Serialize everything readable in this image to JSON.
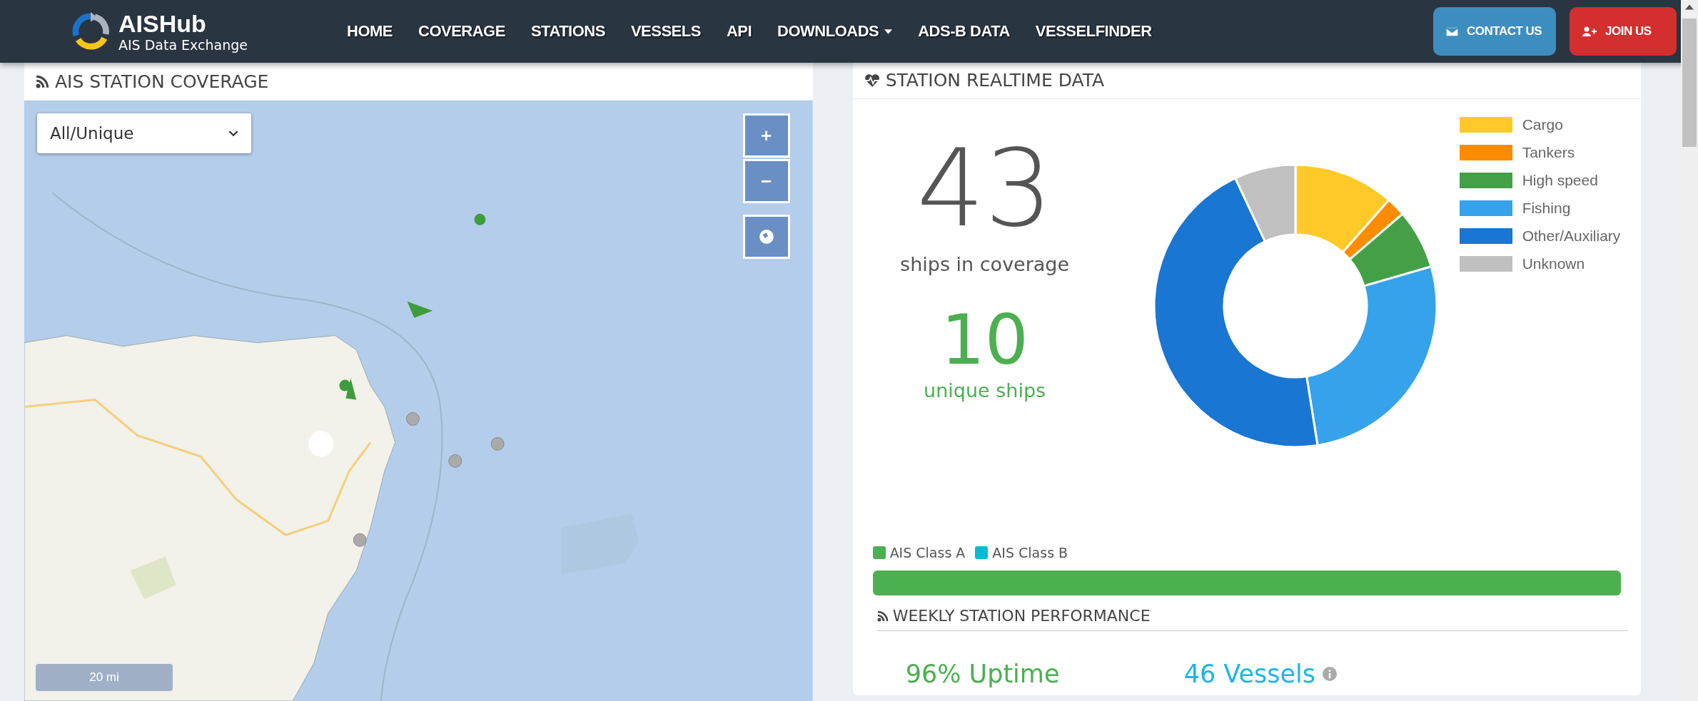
{
  "brand": {
    "name": "AISHub",
    "tagline": "AIS Data Exchange"
  },
  "nav": [
    {
      "label": "HOME",
      "dropdown": false
    },
    {
      "label": "COVERAGE",
      "dropdown": false
    },
    {
      "label": "STATIONS",
      "dropdown": false
    },
    {
      "label": "VESSELS",
      "dropdown": false
    },
    {
      "label": "API",
      "dropdown": false
    },
    {
      "label": "DOWNLOADS",
      "dropdown": true
    },
    {
      "label": "ADS-B DATA",
      "dropdown": false
    },
    {
      "label": "VESSELFINDER",
      "dropdown": false
    }
  ],
  "header_buttons": [
    {
      "label": "CONTACT US",
      "kind": "contact"
    },
    {
      "label": "JOIN US",
      "kind": "join"
    }
  ],
  "coverage": {
    "title": "AIS STATION COVERAGE",
    "map": {
      "kind": "picture",
      "filter": {
        "value": "All/Unique"
      },
      "zoom_in": "+",
      "zoom_out": "−",
      "scale": "20 mi"
    }
  },
  "realtime": {
    "title": "STATION REALTIME DATA",
    "ships_count": "43",
    "ships_label": "ships in coverage",
    "unique_count": "10",
    "unique_label": "unique ships",
    "legend": [
      {
        "label": "Cargo",
        "color": "#ffca28"
      },
      {
        "label": "Tankers",
        "color": "#fb8c00"
      },
      {
        "label": "High speed",
        "color": "#43a047"
      },
      {
        "label": "Fishing",
        "color": "#36a2eb"
      },
      {
        "label": "Other/Auxiliary",
        "color": "#1976d2"
      },
      {
        "label": "Unknown",
        "color": "#c0c0c0"
      }
    ],
    "classes": [
      {
        "label": "AIS Class A",
        "color": "#4caf50"
      },
      {
        "label": "AIS Class B",
        "color": "#00bcd4"
      }
    ],
    "class_bar": {
      "level": 1
    },
    "weekly": {
      "title": "WEEKLY STATION PERFORMANCE",
      "uptime": "96% Uptime",
      "vessels": "46 Vessels"
    }
  }
}
